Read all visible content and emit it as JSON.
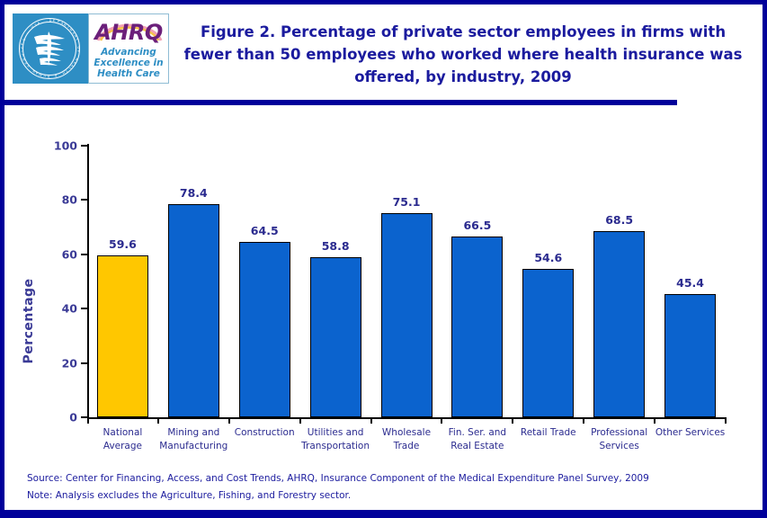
{
  "figure": {
    "title": "Figure 2. Percentage of private sector employees in firms with fewer than 50 employees who worked where health insurance was offered, by industry, 2009"
  },
  "logo": {
    "agency_seal_name": "hhs-seal-icon",
    "wordmark": "AHRQ",
    "tagline_line1": "Advancing",
    "tagline_line2": "Excellence in",
    "tagline_line3": "Health Care"
  },
  "footer": {
    "source": "Source: Center for Financing, Access, and Cost Trends, AHRQ, Insurance Component of the Medical Expenditure Panel Survey, 2009",
    "note": "Note: Analysis excludes the Agriculture, Fishing, and Forestry sector."
  },
  "colors": {
    "frame": "#00009a",
    "title_text": "#1b1b9e",
    "label_text": "#2b2b8f",
    "bar_blue": "#0b63ce",
    "bar_gold": "#ffc700",
    "bar_outline": "#000000",
    "seal_blue": "#2e8ec4",
    "wordmark_purple": "#6b1f7a"
  },
  "chart_data": {
    "type": "bar",
    "title": "Figure 2. Percentage of private sector employees in firms with fewer than 50 employees who worked where health insurance was offered, by industry, 2009",
    "xlabel": "",
    "ylabel": "Percentage",
    "ylim": [
      0,
      100
    ],
    "yticks": [
      0,
      20,
      40,
      60,
      80,
      100
    ],
    "ytick_labels": [
      "0",
      "20",
      "40",
      "60",
      "80",
      "100"
    ],
    "grid": false,
    "legend": "none",
    "categories": [
      "National\nAverage",
      "Mining and\nManufacturing",
      "Construction",
      "Utilities and\nTransportation",
      "Wholesale\nTrade",
      "Fin. Ser. and\nReal Estate",
      "Retail Trade",
      "Professional\nServices",
      "Other Services"
    ],
    "values": [
      59.6,
      78.4,
      64.5,
      58.8,
      75.1,
      66.5,
      54.6,
      68.5,
      45.4
    ],
    "value_labels": [
      "59.6",
      "78.4",
      "64.5",
      "58.8",
      "75.1",
      "66.5",
      "54.6",
      "68.5",
      "45.4"
    ],
    "bar_colors": [
      "#ffc700",
      "#0b63ce",
      "#0b63ce",
      "#0b63ce",
      "#0b63ce",
      "#0b63ce",
      "#0b63ce",
      "#0b63ce",
      "#0b63ce"
    ]
  }
}
